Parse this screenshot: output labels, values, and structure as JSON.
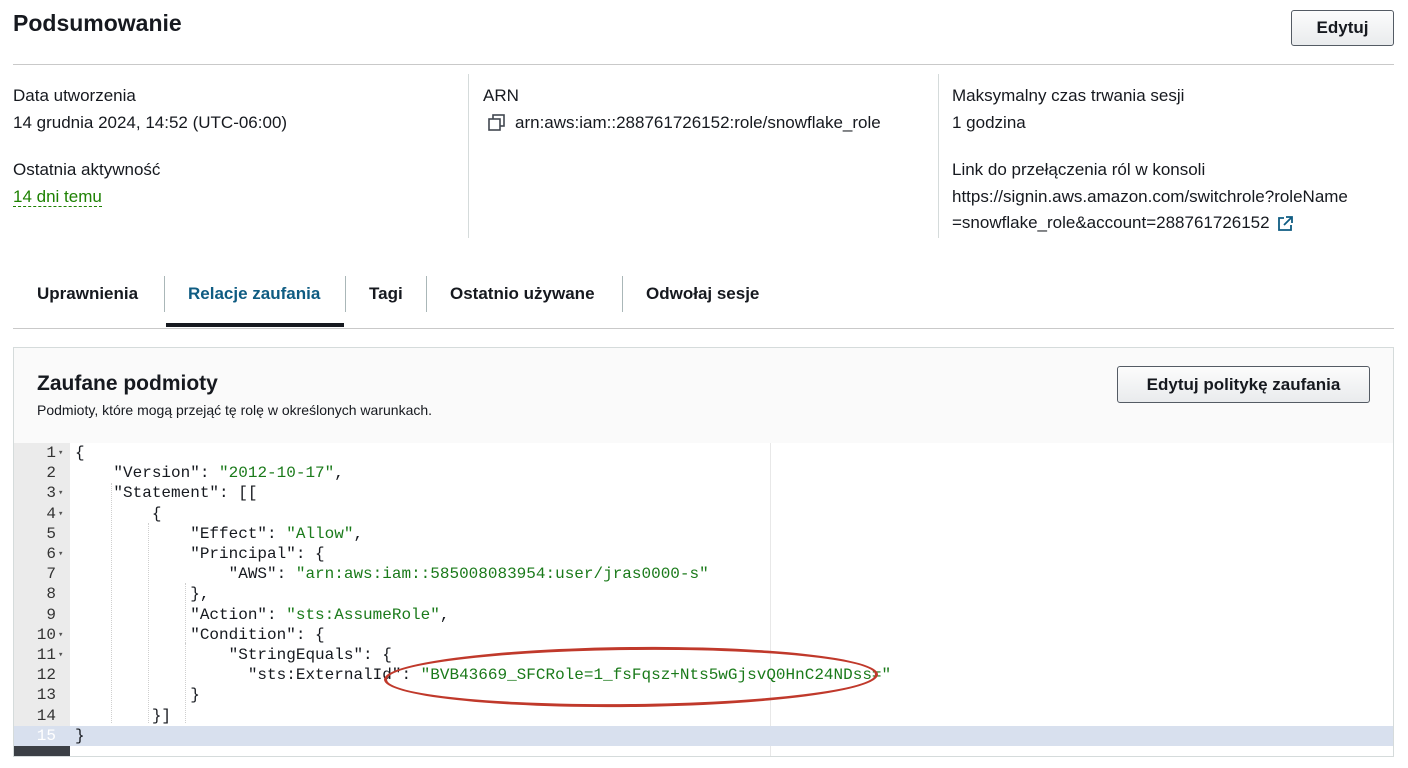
{
  "header": {
    "title": "Podsumowanie",
    "edit_label": "Edytuj"
  },
  "summary": {
    "created_label": "Data utworzenia",
    "created_value": "14 grudnia 2024, 14:52 (UTC-06:00)",
    "last_activity_label": "Ostatnia aktywność",
    "last_activity_value": "14 dni temu",
    "arn_label": "ARN",
    "arn_value": "arn:aws:iam::288761726152:role/snowflake_role",
    "max_session_label": "Maksymalny czas trwania sesji",
    "max_session_value": "1 godzina",
    "switch_link_label": "Link do przełączenia ról w konsoli",
    "switch_link_line1": "https://signin.aws.amazon.com/switchrole?roleName",
    "switch_link_line2": "=snowflake_role&account=288761726152"
  },
  "tabs": [
    {
      "label": "Uprawnienia"
    },
    {
      "label": "Relacje zaufania",
      "active": true
    },
    {
      "label": "Tagi"
    },
    {
      "label": "Ostatnio używane"
    },
    {
      "label": "Odwołaj sesje"
    }
  ],
  "trusted": {
    "title": "Zaufane podmioty",
    "subtitle": "Podmioty, które mogą przejąć tę rolę w określonych warunkach.",
    "edit_policy_label": "Edytuj politykę zaufania"
  },
  "editor": {
    "lines": [
      {
        "n": "1",
        "fold": true,
        "indent": "",
        "key": "",
        "sep": "",
        "str": "",
        "tail": "{"
      },
      {
        "n": "2",
        "fold": false,
        "indent": "    ",
        "key": "\"Version\"",
        "sep": ": ",
        "str": "\"2012-10-17\"",
        "tail": ","
      },
      {
        "n": "3",
        "fold": true,
        "indent": "    ",
        "key": "\"Statement\"",
        "sep": ": ",
        "str": "",
        "tail": "[["
      },
      {
        "n": "4",
        "fold": true,
        "indent": "        ",
        "key": "",
        "sep": "",
        "str": "",
        "tail": "{"
      },
      {
        "n": "5",
        "fold": false,
        "indent": "            ",
        "key": "\"Effect\"",
        "sep": ": ",
        "str": "\"Allow\"",
        "tail": ","
      },
      {
        "n": "6",
        "fold": true,
        "indent": "            ",
        "key": "\"Principal\"",
        "sep": ": ",
        "str": "",
        "tail": "{"
      },
      {
        "n": "7",
        "fold": false,
        "indent": "                ",
        "key": "\"AWS\"",
        "sep": ": ",
        "str": "\"arn:aws:iam::585008083954:user/jras0000-s\"",
        "tail": ""
      },
      {
        "n": "8",
        "fold": false,
        "indent": "            ",
        "key": "",
        "sep": "",
        "str": "",
        "tail": "},"
      },
      {
        "n": "9",
        "fold": false,
        "indent": "            ",
        "key": "\"Action\"",
        "sep": ": ",
        "str": "\"sts:AssumeRole\"",
        "tail": ","
      },
      {
        "n": "10",
        "fold": true,
        "indent": "            ",
        "key": "\"Condition\"",
        "sep": ": ",
        "str": "",
        "tail": "{"
      },
      {
        "n": "11",
        "fold": true,
        "indent": "                ",
        "key": "\"StringEquals\"",
        "sep": ": ",
        "str": "",
        "tail": "{"
      },
      {
        "n": "12",
        "fold": false,
        "indent": "                  ",
        "key": "\"sts:ExternalId\"",
        "sep": ": ",
        "str": "\"BVB43669_SFCRole=1_fsFqsz+Nts5wGjsvQ0HnC24NDss=\"",
        "tail": ""
      },
      {
        "n": "13",
        "fold": false,
        "indent": "            ",
        "key": "",
        "sep": "",
        "str": "",
        "tail": "}"
      },
      {
        "n": "14",
        "fold": false,
        "indent": "        ",
        "key": "",
        "sep": "",
        "str": "",
        "tail": "}]"
      },
      {
        "n": "15",
        "fold": false,
        "indent": "",
        "key": "",
        "sep": "",
        "str": "",
        "tail": "}"
      }
    ]
  },
  "colors": {
    "active_tab": "#0f5c82",
    "string": "#1a7a1a",
    "annotation": "#c0392b",
    "link_green": "#1d8102"
  },
  "icons": {
    "copy": "copy-icon",
    "external": "external-link-icon"
  }
}
